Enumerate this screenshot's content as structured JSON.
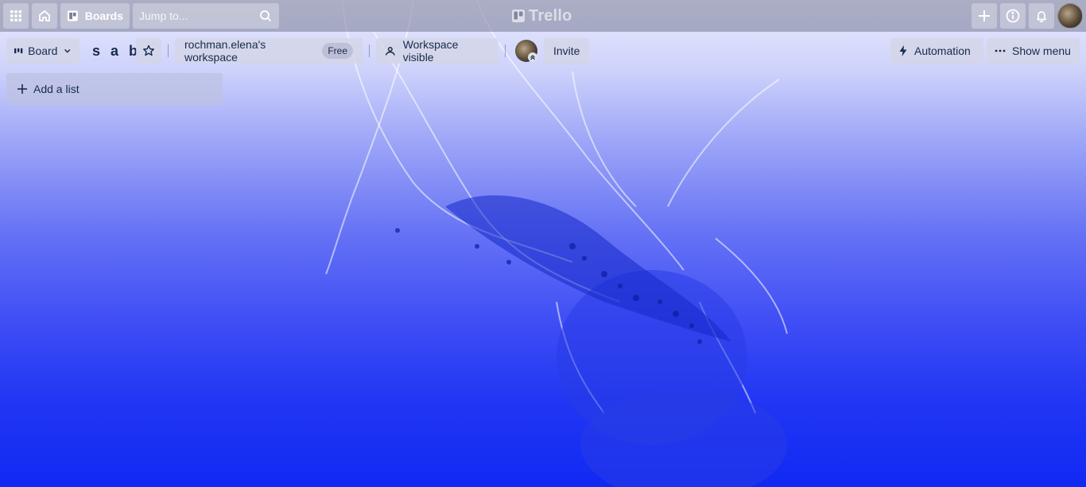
{
  "topbar": {
    "boards_label": "Boards",
    "search_placeholder": "Jump to...",
    "logo_text": "Trello"
  },
  "board": {
    "view_label": "Board",
    "title": "s a b",
    "workspace_name": "rochman.elena's workspace",
    "workspace_plan": "Free",
    "visibility_label": "Workspace visible",
    "invite_label": "Invite",
    "automation_label": "Automation",
    "show_menu_label": "Show menu"
  },
  "lists": {
    "add_list_label": "Add a list"
  },
  "colors": {
    "text_primary": "#172b4d",
    "background_top": "#e8eafc",
    "background_bottom": "#1029f3"
  },
  "icons": [
    "apps-grid-icon",
    "home-icon",
    "boards-icon",
    "search-icon",
    "trello-logo-icon",
    "plus-icon",
    "info-icon",
    "bell-icon",
    "board-view-icon",
    "chevron-down-icon",
    "star-icon",
    "visibility-icon",
    "lightning-icon",
    "more-icon"
  ]
}
